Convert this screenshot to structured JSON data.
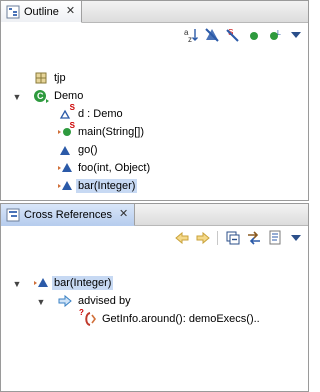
{
  "outline": {
    "tab_title": "Outline",
    "tree": [
      {
        "label": "tjp",
        "icon": "package-icon"
      },
      {
        "label": "Demo",
        "icon": "class-icon"
      },
      {
        "label": "d : Demo",
        "icon": "field-icon"
      },
      {
        "label": "main(String[])",
        "icon": "method-icon"
      },
      {
        "label": "go()",
        "icon": "method-icon"
      },
      {
        "label": "foo(int, Object)",
        "icon": "method-icon"
      },
      {
        "label": "bar(Integer)",
        "icon": "method-icon"
      }
    ],
    "toolbar": [
      "sort-az-icon",
      "hide-fields-icon",
      "hide-static-icon",
      "hide-nonpublic-icon",
      "hide-local-types-icon",
      "view-menu-icon"
    ]
  },
  "xref": {
    "tab_title": "Cross References",
    "tree": [
      {
        "label": "bar(Integer)"
      },
      {
        "label": "advised by"
      },
      {
        "label": "GetInfo.around(): demoExecs().."
      }
    ],
    "toolbar": [
      "back-icon",
      "forward-icon",
      "collapse-all-icon",
      "link-editor-icon",
      "show-details-icon",
      "view-menu-icon"
    ]
  },
  "colors": {
    "selection": "#c7d9f3",
    "tab_active": "#b7cdee",
    "method_blue": "#2b5aa8",
    "public_green": "#2e9a3e"
  }
}
